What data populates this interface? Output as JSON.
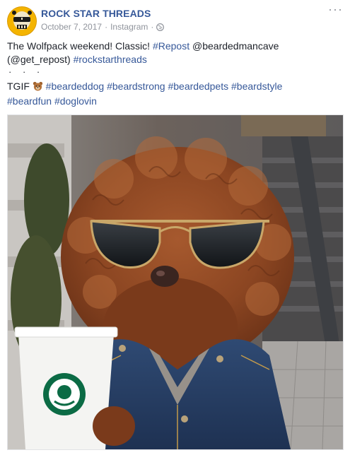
{
  "post": {
    "page_name": "ROCK STAR THREADS",
    "date": "October 7, 2017",
    "source": "Instagram",
    "separator": "·",
    "more_label": "···",
    "line1_plain": "The Wolfpack weekend! Classic! ",
    "line1_tag": "#Repost",
    "line1_mention": " @beardedmancave",
    "line2_plain": "(@get_repost) ",
    "line2_tag": "#rockstarthreads",
    "dots": "· · ·",
    "tgif": "TGIF",
    "tags_line3": "#beardeddog #beardstrong #beardedpets #beardstyle",
    "tags_line4": "#beardfun #doglovin"
  },
  "icons": {
    "avatar": "skull-sunglasses-logo",
    "globe": "globe-icon",
    "emoji": "bear-emoji",
    "more": "more-options-icon"
  },
  "colors": {
    "link": "#365899",
    "meta": "#90949c",
    "text": "#1d2129"
  }
}
